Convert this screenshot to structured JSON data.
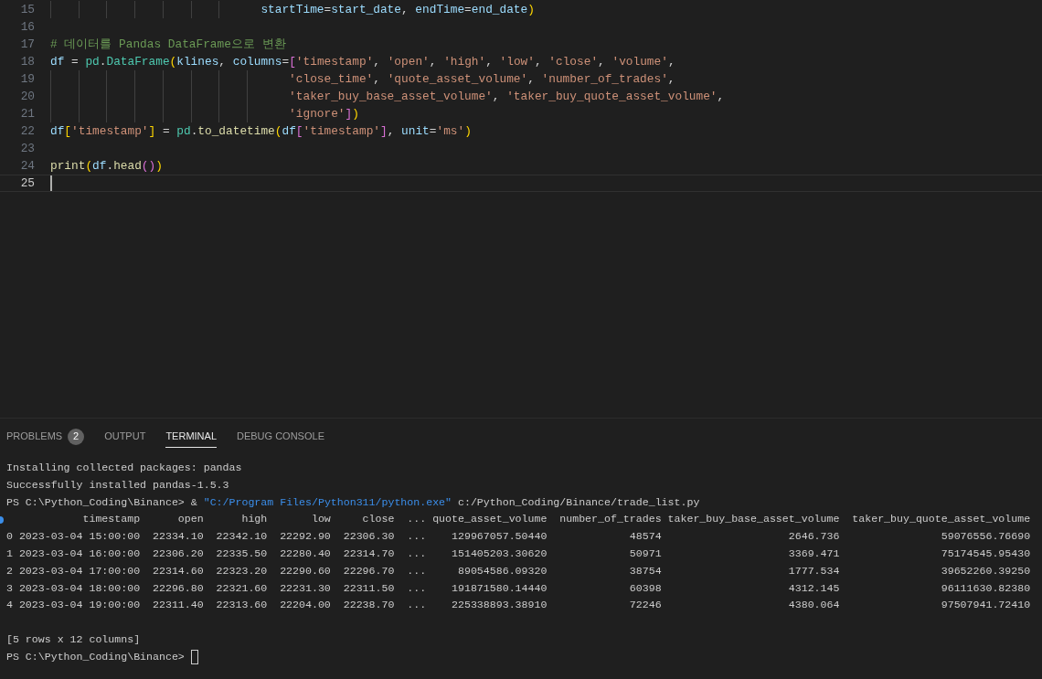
{
  "editor": {
    "lines": [
      {
        "number": "15",
        "current": false,
        "tokens": [
          {
            "kind": "var",
            "text": "                              startTime"
          },
          {
            "kind": "plain",
            "text": "="
          },
          {
            "kind": "var",
            "text": "start_date"
          },
          {
            "kind": "plain",
            "text": ", "
          },
          {
            "kind": "var",
            "text": "endTime"
          },
          {
            "kind": "plain",
            "text": "="
          },
          {
            "kind": "var",
            "text": "end_date"
          },
          {
            "kind": "bracket1",
            "text": ")"
          }
        ]
      },
      {
        "number": "16",
        "current": false
      },
      {
        "number": "17",
        "current": false,
        "tokens": [
          {
            "kind": "comment",
            "text": "# 데이터를 Pandas DataFrame으로 변환"
          }
        ]
      },
      {
        "number": "18",
        "current": false,
        "tokens": [
          {
            "kind": "var",
            "text": "df"
          },
          {
            "kind": "plain",
            "text": " = "
          },
          {
            "kind": "class",
            "text": "pd"
          },
          {
            "kind": "plain",
            "text": "."
          },
          {
            "kind": "class",
            "text": "DataFrame"
          },
          {
            "kind": "bracket1",
            "text": "("
          },
          {
            "kind": "var",
            "text": "klines"
          },
          {
            "kind": "plain",
            "text": ", "
          },
          {
            "kind": "var",
            "text": "columns"
          },
          {
            "kind": "plain",
            "text": "="
          },
          {
            "kind": "bracket2",
            "text": "["
          },
          {
            "kind": "string",
            "text": "'timestamp'"
          },
          {
            "kind": "plain",
            "text": ", "
          },
          {
            "kind": "string",
            "text": "'open'"
          },
          {
            "kind": "plain",
            "text": ", "
          },
          {
            "kind": "string",
            "text": "'high'"
          },
          {
            "kind": "plain",
            "text": ", "
          },
          {
            "kind": "string",
            "text": "'low'"
          },
          {
            "kind": "plain",
            "text": ", "
          },
          {
            "kind": "string",
            "text": "'close'"
          },
          {
            "kind": "plain",
            "text": ", "
          },
          {
            "kind": "string",
            "text": "'volume'"
          },
          {
            "kind": "plain",
            "text": ","
          }
        ]
      },
      {
        "number": "19",
        "current": false,
        "tokens": [
          {
            "kind": "string",
            "text": "                                  'close_time'"
          },
          {
            "kind": "plain",
            "text": ", "
          },
          {
            "kind": "string",
            "text": "'quote_asset_volume'"
          },
          {
            "kind": "plain",
            "text": ", "
          },
          {
            "kind": "string",
            "text": "'number_of_trades'"
          },
          {
            "kind": "plain",
            "text": ","
          }
        ]
      },
      {
        "number": "20",
        "current": false,
        "tokens": [
          {
            "kind": "string",
            "text": "                                  'taker_buy_base_asset_volume'"
          },
          {
            "kind": "plain",
            "text": ", "
          },
          {
            "kind": "string",
            "text": "'taker_buy_quote_asset_volume'"
          },
          {
            "kind": "plain",
            "text": ","
          }
        ]
      },
      {
        "number": "21",
        "current": false,
        "tokens": [
          {
            "kind": "string",
            "text": "                                  'ignore'"
          },
          {
            "kind": "bracket2",
            "text": "]"
          },
          {
            "kind": "bracket1",
            "text": ")"
          }
        ]
      },
      {
        "number": "22",
        "current": false,
        "tokens": [
          {
            "kind": "var",
            "text": "df"
          },
          {
            "kind": "bracket1",
            "text": "["
          },
          {
            "kind": "string",
            "text": "'timestamp'"
          },
          {
            "kind": "bracket1",
            "text": "]"
          },
          {
            "kind": "plain",
            "text": " = "
          },
          {
            "kind": "class",
            "text": "pd"
          },
          {
            "kind": "plain",
            "text": "."
          },
          {
            "kind": "func",
            "text": "to_datetime"
          },
          {
            "kind": "bracket1",
            "text": "("
          },
          {
            "kind": "var",
            "text": "df"
          },
          {
            "kind": "bracket2",
            "text": "["
          },
          {
            "kind": "string",
            "text": "'timestamp'"
          },
          {
            "kind": "bracket2",
            "text": "]"
          },
          {
            "kind": "plain",
            "text": ", "
          },
          {
            "kind": "var",
            "text": "unit"
          },
          {
            "kind": "plain",
            "text": "="
          },
          {
            "kind": "string",
            "text": "'ms'"
          },
          {
            "kind": "bracket1",
            "text": ")"
          }
        ]
      },
      {
        "number": "23",
        "current": false
      },
      {
        "number": "24",
        "current": false,
        "tokens": [
          {
            "kind": "func",
            "text": "print"
          },
          {
            "kind": "bracket1",
            "text": "("
          },
          {
            "kind": "var",
            "text": "df"
          },
          {
            "kind": "plain",
            "text": "."
          },
          {
            "kind": "func",
            "text": "head"
          },
          {
            "kind": "bracket2",
            "text": "()"
          },
          {
            "kind": "bracket1",
            "text": ")"
          }
        ]
      },
      {
        "number": "25",
        "current": true
      }
    ]
  },
  "panel": {
    "tabs": [
      {
        "label": "PROBLEMS",
        "badge": "2",
        "selected": false
      },
      {
        "label": "OUTPUT",
        "selected": false
      },
      {
        "label": "TERMINAL",
        "selected": true
      },
      {
        "label": "DEBUG CONSOLE",
        "selected": false
      }
    ],
    "terminal": {
      "blocks": [
        {
          "lines": [
            {
              "segments": [
                {
                  "kind": "plain",
                  "text": "Installing collected packages: pandas"
                }
              ]
            },
            {
              "segments": [
                {
                  "kind": "plain",
                  "text": "Successfully installed pandas-1.5.3"
                }
              ]
            },
            {
              "segments": [
                {
                  "kind": "plain",
                  "text": "PS C:\\Python_Coding\\Binance> & "
                },
                {
                  "kind": "path",
                  "text": "\"C:/Program Files/Python311/python.exe\""
                },
                {
                  "kind": "plain",
                  "text": " c:/Python_Coding/Binance/trade_list.py"
                }
              ]
            },
            {
              "marker": true,
              "segments": [
                {
                  "kind": "plain",
                  "text": "            timestamp      open      high       low     close  ... quote_asset_volume  number_of_trades taker_buy_base_asset_volume  taker_buy_quote_asset_volume"
                }
              ]
            },
            {
              "segments": [
                {
                  "kind": "plain",
                  "text": "0 2023-03-04 15:00:00  22334.10  22342.10  22292.90  22306.30  ...    129967057.50440             48574                    2646.736                59076556.76690"
                }
              ]
            },
            {
              "segments": [
                {
                  "kind": "plain",
                  "text": "1 2023-03-04 16:00:00  22306.20  22335.50  22280.40  22314.70  ...    151405203.30620             50971                    3369.471                75174545.95430"
                }
              ]
            },
            {
              "segments": [
                {
                  "kind": "plain",
                  "text": "2 2023-03-04 17:00:00  22314.60  22323.20  22290.60  22296.70  ...     89054586.09320             38754                    1777.534                39652260.39250"
                }
              ]
            },
            {
              "segments": [
                {
                  "kind": "plain",
                  "text": "3 2023-03-04 18:00:00  22296.80  22321.60  22231.30  22311.50  ...    191871580.14440             60398                    4312.145                96111630.82380"
                }
              ]
            },
            {
              "segments": [
                {
                  "kind": "plain",
                  "text": "4 2023-03-04 19:00:00  22311.40  22313.60  22204.00  22238.70  ...    225338893.38910             72246                    4380.064                97507941.72410"
                }
              ]
            }
          ]
        },
        {
          "lines": [
            {
              "segments": [
                {
                  "kind": "plain",
                  "text": "[5 rows x 12 columns]"
                }
              ]
            },
            {
              "segments": [
                {
                  "kind": "plain",
                  "text": "PS C:\\Python_Coding\\Binance> "
                }
              ]
            }
          ]
        }
      ],
      "cursor": true
    }
  }
}
